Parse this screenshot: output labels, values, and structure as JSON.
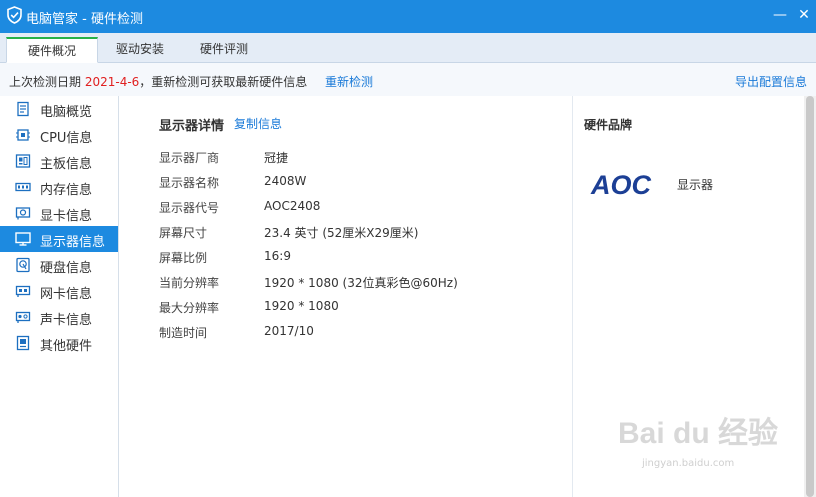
{
  "window": {
    "title": "电脑管家 - 硬件检测",
    "minimize_glyph": "—",
    "close_glyph": "✕",
    "icon": "shield-check-icon"
  },
  "tabs": [
    {
      "label": "硬件概况",
      "active": true
    },
    {
      "label": "驱动安装",
      "active": false
    },
    {
      "label": "硬件评测",
      "active": false
    }
  ],
  "infobar": {
    "prefix": "上次检测日期 ",
    "date": "2021-4-6",
    "suffix": "，重新检测可获取最新硬件信息",
    "recheck_label": "重新检测",
    "export_label": "导出配置信息"
  },
  "sidebar": {
    "items": [
      {
        "label": "电脑概览",
        "icon": "overview-icon",
        "active": false
      },
      {
        "label": "CPU信息",
        "icon": "cpu-icon",
        "active": false
      },
      {
        "label": "主板信息",
        "icon": "motherboard-icon",
        "active": false
      },
      {
        "label": "内存信息",
        "icon": "memory-icon",
        "active": false
      },
      {
        "label": "显卡信息",
        "icon": "graphics-card-icon",
        "active": false
      },
      {
        "label": "显示器信息",
        "icon": "monitor-icon",
        "active": true
      },
      {
        "label": "硬盘信息",
        "icon": "disk-icon",
        "active": false
      },
      {
        "label": "网卡信息",
        "icon": "network-card-icon",
        "active": false
      },
      {
        "label": "声卡信息",
        "icon": "sound-card-icon",
        "active": false
      },
      {
        "label": "其他硬件",
        "icon": "other-hardware-icon",
        "active": false
      }
    ]
  },
  "details": {
    "title": "显示器详情",
    "copy_label": "复制信息",
    "rows": [
      {
        "key": "显示器厂商",
        "value": "冠捷"
      },
      {
        "key": "显示器名称",
        "value": "2408W"
      },
      {
        "key": "显示器代号",
        "value": "AOC2408"
      },
      {
        "key": "屏幕尺寸",
        "value": "23.4 英寸 (52厘米X29厘米)"
      },
      {
        "key": "屏幕比例",
        "value": "16:9"
      },
      {
        "key": "当前分辨率",
        "value": "1920 * 1080 (32位真彩色@60Hz)"
      },
      {
        "key": "最大分辨率",
        "value": "1920 * 1080"
      },
      {
        "key": "制造时间",
        "value": "2017/10"
      }
    ]
  },
  "brand": {
    "title": "硬件品牌",
    "logo_text": "AOC",
    "device_type": "显示器"
  },
  "watermark": {
    "text": "Bai du 经验",
    "sub": "jingyan.baidu.com"
  },
  "colors": {
    "accent": "#1d8ae0",
    "date_red": "#e02020",
    "link_blue": "#1a7ad8",
    "active_tab_green": "#27b148",
    "aoc_blue": "#1c3f95"
  }
}
